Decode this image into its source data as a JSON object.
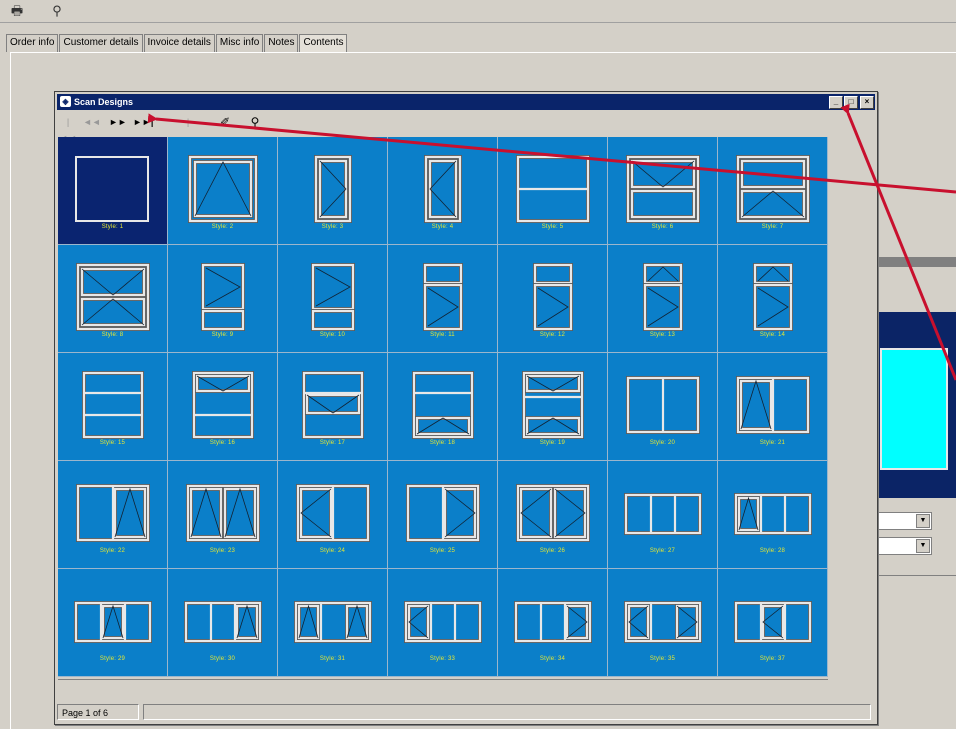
{
  "toolbar": {
    "icons": [
      "printer-icon",
      "find-icon"
    ]
  },
  "tabs": [
    "Order info",
    "Customer details",
    "Invoice details",
    "Misc info",
    "Notes",
    "Contents"
  ],
  "active_tab": "Contents",
  "dialog": {
    "title": "Scan Designs",
    "nav": [
      "|◄◄",
      "◄◄",
      "►►",
      "►►|"
    ],
    "status": "Page 1 of 6"
  },
  "designs": [
    {
      "label": "Style: 1"
    },
    {
      "label": "Style: 2"
    },
    {
      "label": "Style: 3"
    },
    {
      "label": "Style: 4"
    },
    {
      "label": "Style: 5"
    },
    {
      "label": "Style: 6"
    },
    {
      "label": "Style: 7"
    },
    {
      "label": "Style: 8"
    },
    {
      "label": "Style: 9"
    },
    {
      "label": "Style: 10"
    },
    {
      "label": "Style: 11"
    },
    {
      "label": "Style: 12"
    },
    {
      "label": "Style: 13"
    },
    {
      "label": "Style: 14"
    },
    {
      "label": "Style: 15"
    },
    {
      "label": "Style: 16"
    },
    {
      "label": "Style: 17"
    },
    {
      "label": "Style: 18"
    },
    {
      "label": "Style: 19"
    },
    {
      "label": "Style: 20"
    },
    {
      "label": "Style: 21"
    },
    {
      "label": "Style: 22"
    },
    {
      "label": "Style: 23"
    },
    {
      "label": "Style: 24"
    },
    {
      "label": "Style: 25"
    },
    {
      "label": "Style: 26"
    },
    {
      "label": "Style: 27"
    },
    {
      "label": "Style: 28"
    },
    {
      "label": "Style: 29"
    },
    {
      "label": "Style: 30"
    },
    {
      "label": "Style: 31"
    },
    {
      "label": "Style: 33"
    },
    {
      "label": "Style: 34"
    },
    {
      "label": "Style: 35"
    },
    {
      "label": "Style: 37"
    }
  ],
  "selected_index": 0,
  "colors": {
    "grid_cell": "#0b7fc9",
    "selected_cell": "#0a2470",
    "label": "#e8e830",
    "titlebar": "#0a246a",
    "annotation_arrow": "#c8102e"
  }
}
